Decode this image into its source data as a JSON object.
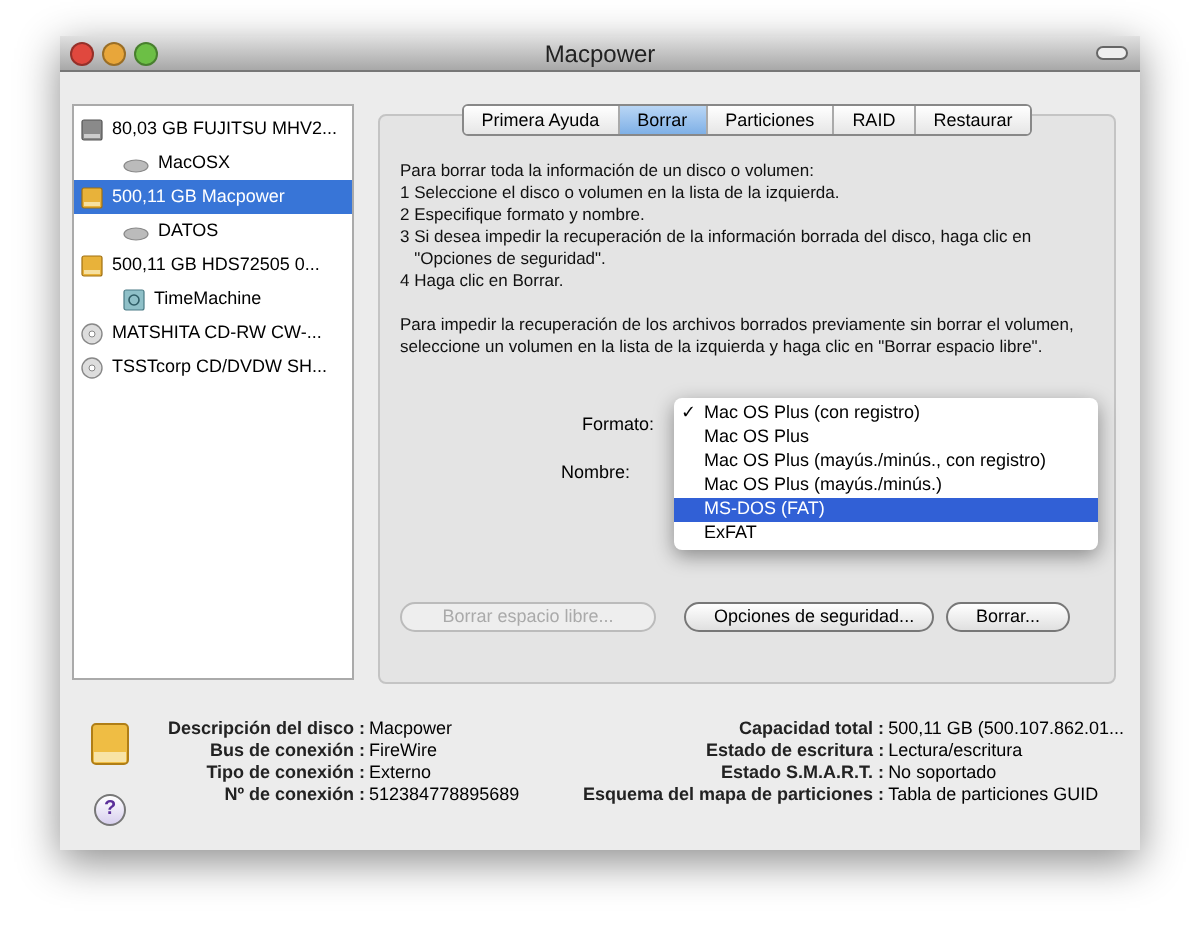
{
  "window": {
    "title": "Macpower"
  },
  "sidebar": {
    "items": [
      {
        "label": "80,03 GB FUJITSU MHV2...",
        "kind": "disk",
        "selected": false,
        "children": [
          {
            "label": "MacOSX",
            "kind": "volume",
            "selected": false
          }
        ]
      },
      {
        "label": "500,11 GB Macpower",
        "kind": "external",
        "selected": true,
        "children": [
          {
            "label": "DATOS",
            "kind": "volume",
            "selected": false
          }
        ]
      },
      {
        "label": "500,11 GB HDS72505 0...",
        "kind": "external",
        "selected": false,
        "children": [
          {
            "label": "TimeMachine",
            "kind": "timemachine",
            "selected": false
          }
        ]
      },
      {
        "label": "MATSHITA CD-RW CW-...",
        "kind": "optical",
        "selected": false
      },
      {
        "label": "TSSTcorp CD/DVDW SH...",
        "kind": "optical",
        "selected": false
      }
    ]
  },
  "tabs": [
    {
      "label": "Primera Ayuda",
      "selected": false
    },
    {
      "label": "Borrar",
      "selected": true
    },
    {
      "label": "Particiones",
      "selected": false
    },
    {
      "label": "RAID",
      "selected": false
    },
    {
      "label": "Restaurar",
      "selected": false
    }
  ],
  "instructions": [
    "Para borrar toda la información de un disco o volumen:",
    "1 Seleccione el disco o volumen en la lista de la izquierda.",
    "2 Especifique formato y nombre.",
    "3 Si desea impedir la recuperación de la información borrada del disco, haga clic en",
    "   \"Opciones de seguridad\".",
    "4 Haga clic en Borrar."
  ],
  "note": "Para impedir la recuperación de los archivos borrados previamente sin borrar el volumen, seleccione un volumen en la lista de la izquierda y haga clic en \"Borrar espacio libre\".",
  "format_label": "Formato:",
  "name_label": "Nombre:",
  "format_menu": [
    {
      "label": "Mac OS Plus (con registro)",
      "checked": true,
      "selected": false
    },
    {
      "label": "Mac OS Plus",
      "checked": false,
      "selected": false
    },
    {
      "label": "Mac OS Plus (mayús./minús., con registro)",
      "checked": false,
      "selected": false
    },
    {
      "label": "Mac OS Plus (mayús./minús.)",
      "checked": false,
      "selected": false
    },
    {
      "label": "MS-DOS (FAT)",
      "checked": false,
      "selected": true
    },
    {
      "label": "ExFAT",
      "checked": false,
      "selected": false
    }
  ],
  "check_mark": "✓",
  "buttons": [
    {
      "label": "Borrar espacio libre...",
      "disabled": true
    },
    {
      "label": "Opciones de seguridad...",
      "disabled": false
    },
    {
      "label": "Borrar...",
      "disabled": false
    }
  ],
  "info_left": [
    {
      "label": "Descripción del disco :",
      "value": "Macpower"
    },
    {
      "label": "Bus de conexión :",
      "value": "FireWire"
    },
    {
      "label": "Tipo de conexión :",
      "value": "Externo"
    },
    {
      "label": "Nº de conexión :",
      "value": "512384778895689"
    }
  ],
  "info_right": [
    {
      "label": "Capacidad total :",
      "value": "500,11 GB (500.107.862.01..."
    },
    {
      "label": "Estado de escritura :",
      "value": "Lectura/escritura"
    },
    {
      "label": "Estado S.M.A.R.T. :",
      "value": "No soportado"
    },
    {
      "label": "Esquema del mapa de particiones :",
      "value": "Tabla de particiones GUID"
    }
  ],
  "help_button": "?"
}
